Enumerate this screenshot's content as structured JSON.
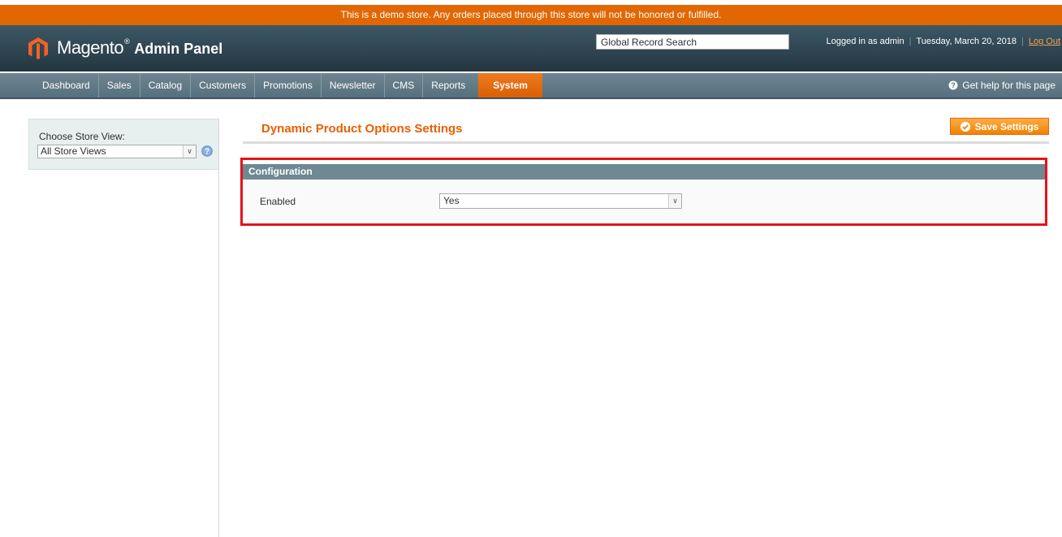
{
  "demo_notice": "This is a demo store. Any orders placed through this store will not be honored or fulfilled.",
  "header": {
    "logo_text": "Magento",
    "logo_trademark": "®",
    "logo_suffix": "Admin Panel",
    "search_value": "Global Record Search",
    "logged_in": "Logged in as admin",
    "date": "Tuesday, March 20, 2018",
    "logout": "Log Out"
  },
  "nav": {
    "items": [
      "Dashboard",
      "Sales",
      "Catalog",
      "Customers",
      "Promotions",
      "Newsletter",
      "CMS",
      "Reports"
    ],
    "active": "System",
    "help": "Get help for this page"
  },
  "sidebar": {
    "store_label": "Choose Store View:",
    "store_value": "All Store Views"
  },
  "main": {
    "title": "Dynamic Product Options Settings",
    "save_label": "Save Settings",
    "section_title": "Configuration",
    "field_label": "Enabled",
    "field_value": "Yes"
  },
  "colors": {
    "accent_orange": "#eb5e00",
    "header_bg": "#2d4550",
    "highlight_border": "#e4141b"
  }
}
